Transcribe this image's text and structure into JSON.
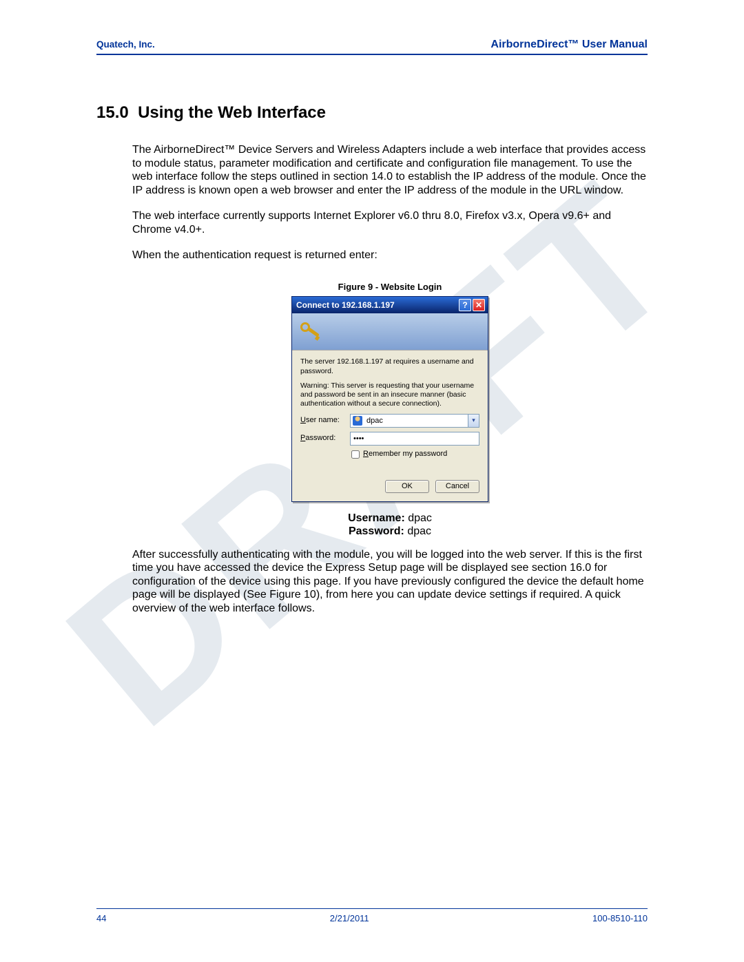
{
  "watermark": "DRAFT",
  "header": {
    "left": "Quatech, Inc.",
    "right": "AirborneDirect™ User Manual"
  },
  "section": {
    "number": "15.0",
    "title": "Using the Web Interface"
  },
  "paragraphs": {
    "p1": "The AirborneDirect™ Device Servers and Wireless Adapters include a web interface that provides access to module status, parameter modification and certificate and configuration file management. To use the web interface follow the steps outlined in section 14.0 to establish the IP address of the module. Once the IP address is known open a web browser and enter the IP address of the module in the URL window.",
    "p2": "The web interface currently supports Internet Explorer v6.0 thru 8.0, Firefox v3.x, Opera v9.6+ and Chrome v4.0+.",
    "p3": "When the authentication request is returned enter:",
    "p4": "After successfully authenticating with the module, you will be logged into the web server. If this is the first time you have accessed the device the Express Setup page will be displayed see section 16.0 for configuration of the device using this page. If you have previously configured the device the default home page will be displayed (See Figure 10), from here you can update device settings if required. A quick overview of the web interface follows."
  },
  "figure_caption": "Figure 9 - Website Login",
  "dialog": {
    "title": "Connect to 192.168.1.197",
    "msg1": "The server 192.168.1.197 at  requires a username and password.",
    "msg2": "Warning: This server is requesting that your username and password be sent in an insecure manner (basic authentication without a secure connection).",
    "username_label_pre": "U",
    "username_label_rest": "ser name:",
    "password_label_pre": "P",
    "password_label_rest": "assword:",
    "username_value": "dpac",
    "password_value": "••••",
    "remember_pre": "R",
    "remember_rest": "emember my password",
    "ok": "OK",
    "cancel": "Cancel"
  },
  "credentials": {
    "username_label": "Username:",
    "username_value": "dpac",
    "password_label": "Password:",
    "password_value": "dpac"
  },
  "footer": {
    "page": "44",
    "date": "2/21/2011",
    "doc": "100-8510-110"
  }
}
